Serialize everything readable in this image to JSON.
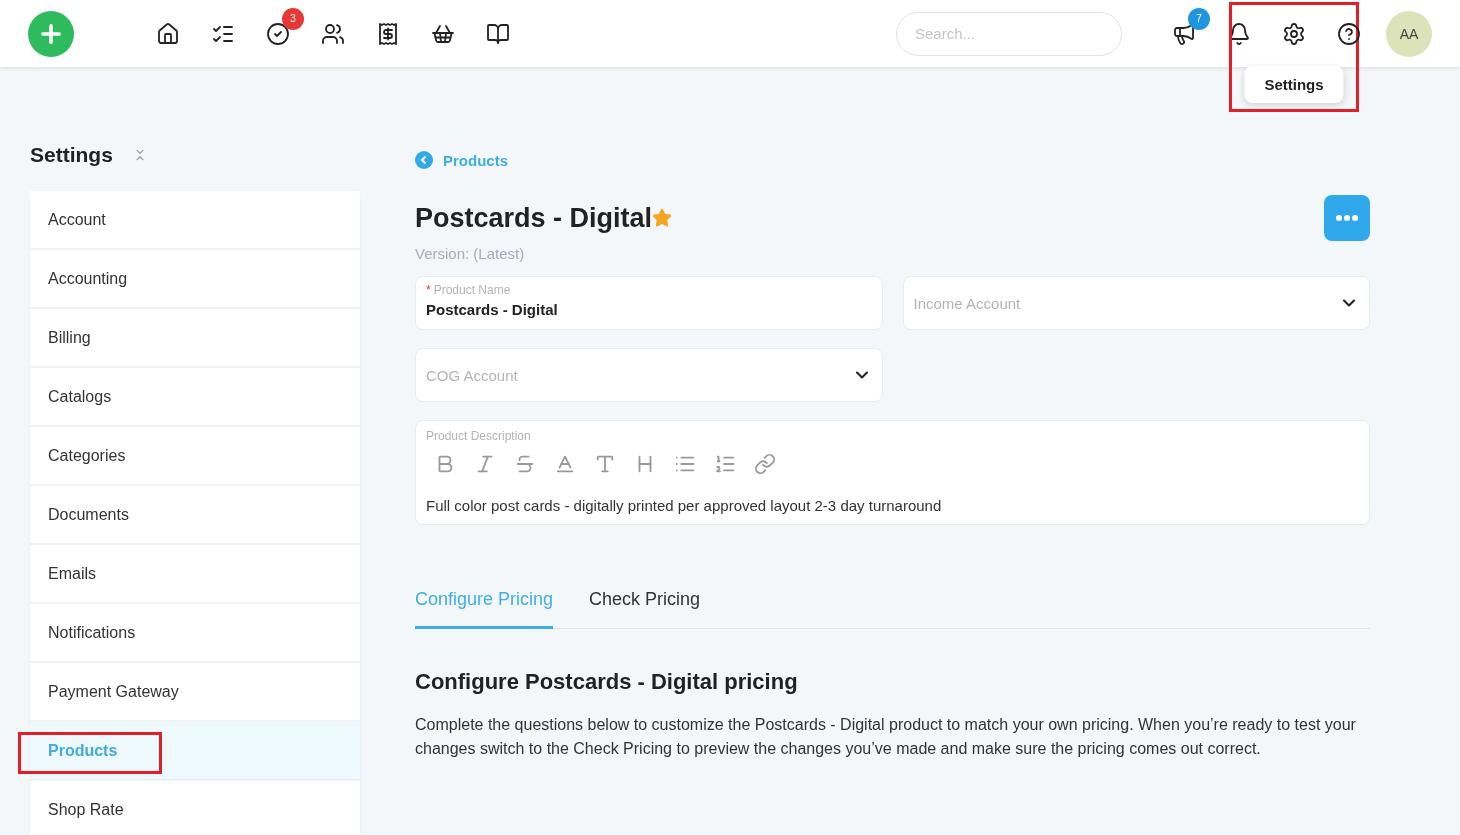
{
  "topbar": {
    "nav": [
      {
        "kind": "home"
      },
      {
        "kind": "tasks"
      },
      {
        "kind": "approvals",
        "badge": "3"
      },
      {
        "kind": "customers"
      },
      {
        "kind": "invoices"
      },
      {
        "kind": "shop"
      },
      {
        "kind": "catalog"
      }
    ],
    "search": {
      "placeholder": "Search..."
    },
    "actions": [
      {
        "kind": "announcements",
        "badge": "7"
      },
      {
        "kind": "notifications"
      },
      {
        "kind": "settings",
        "tooltip": "Settings",
        "highlighted": true
      },
      {
        "kind": "help"
      }
    ],
    "avatar": "AA"
  },
  "sidebar": {
    "title": "Settings",
    "items": [
      {
        "label": "Account",
        "selected": false,
        "highlighted": false
      },
      {
        "label": "Accounting",
        "selected": false,
        "highlighted": false
      },
      {
        "label": "Billing",
        "selected": false,
        "highlighted": false
      },
      {
        "label": "Catalogs",
        "selected": false,
        "highlighted": false
      },
      {
        "label": "Categories",
        "selected": false,
        "highlighted": false
      },
      {
        "label": "Documents",
        "selected": false,
        "highlighted": false
      },
      {
        "label": "Emails",
        "selected": false,
        "highlighted": false
      },
      {
        "label": "Notifications",
        "selected": false,
        "highlighted": false
      },
      {
        "label": "Payment Gateway",
        "selected": false,
        "highlighted": false
      },
      {
        "label": "Products",
        "selected": true,
        "highlighted": true
      },
      {
        "label": "Shop Rate",
        "selected": false,
        "highlighted": false
      }
    ]
  },
  "main": {
    "breadcrumb": "Products",
    "title": "Postcards - Digital",
    "starred": true,
    "version": "Version: (Latest)",
    "product_name": {
      "label": "Product Name",
      "required_mark": "*",
      "value": "Postcards - Digital"
    },
    "income_account": {
      "placeholder": "Income Account"
    },
    "cog_account": {
      "placeholder": "COG Account"
    },
    "description": {
      "label": "Product Description",
      "tools": [
        {
          "kind": "bold"
        },
        {
          "kind": "italic"
        },
        {
          "kind": "strike"
        },
        {
          "kind": "color"
        },
        {
          "kind": "size"
        },
        {
          "kind": "heading"
        },
        {
          "kind": "bullets"
        },
        {
          "kind": "numbers"
        },
        {
          "kind": "link"
        }
      ],
      "value": "Full color post cards - digitally printed per approved layout 2-3 day turnaround"
    },
    "tabs": [
      {
        "label": "Configure Pricing",
        "selected": true
      },
      {
        "label": "Check Pricing",
        "selected": false
      }
    ],
    "section_title": "Configure Postcards - Digital pricing",
    "section_text": "Complete the questions below to customize the Postcards - Digital product to match your own pricing. When you’re ready to test your changes switch to the Check Pricing to preview the changes you’ve made and make sure the pricing comes out correct."
  }
}
